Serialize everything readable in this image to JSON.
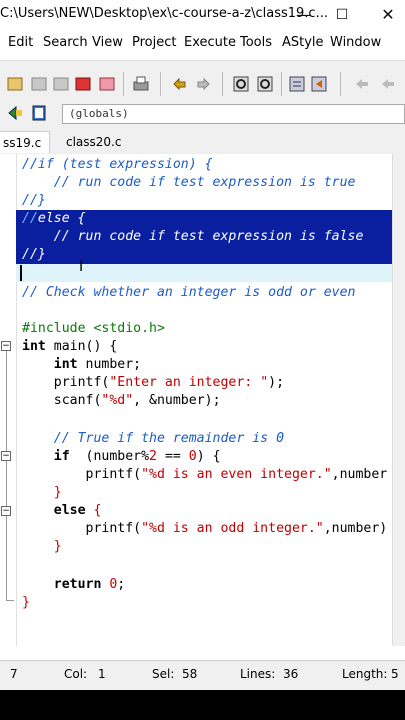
{
  "window": {
    "title": "C:\\Users\\NEW\\Desktop\\ex\\c-course-a-z\\class19.c...",
    "minimize": "—",
    "maximize": "☐",
    "close": "✕"
  },
  "menu": [
    "Edit",
    "Search",
    "View",
    "Project",
    "Execute",
    "Tools",
    "AStyle",
    "Window"
  ],
  "toolbar": {
    "globals": "(globals)",
    "icons": [
      "new-file-icon",
      "open-icon",
      "save-icon",
      "save-all-icon",
      "close-icon",
      "print-icon",
      "undo-icon",
      "redo-icon",
      "find-icon",
      "replace-icon",
      "compile-icon",
      "run-icon",
      "indent-icon",
      "unindent-icon",
      "bookmark-icon",
      "class-browser-icon"
    ]
  },
  "tabs": [
    "ss19.c",
    "class20.c"
  ],
  "code": {
    "l1": "//if (test expression) {",
    "l2": "    // run code if test expression is true",
    "l3": "//}",
    "l4a": "//",
    "l4b": "else {",
    "l5": "    // run code if test expression is false",
    "l6": "//}",
    "l8": "// Check whether an integer is odd or even",
    "l10a": "#include ",
    "l10b": "<stdio.h>",
    "l11a": "int",
    "l11b": " main() {",
    "l12a": "    int",
    "l12b": " number;",
    "l13a": "    printf(",
    "l13b": "\"Enter an integer: \"",
    "l13c": ");",
    "l14a": "    scanf(",
    "l14b": "\"%d\"",
    "l14c": ", &number);",
    "l16": "    // True if the remainder is 0",
    "l17a": "    if",
    "l17b": "  (number%",
    "l17c": "2",
    "l17d": " == ",
    "l17e": "0",
    "l17f": ") {",
    "l18a": "        printf(",
    "l18b": "\"%d is an even integer.\"",
    "l18c": ",number",
    "l19": "    }",
    "l20a": "    else",
    "l20b": " {",
    "l21a": "        printf(",
    "l21b": "\"%d is an odd integer.\"",
    "l21c": ",number)",
    "l22": "    }",
    "l24a": "    return ",
    "l24b": "0",
    "l24c": ";",
    "l25": "}"
  },
  "status": {
    "line": "7",
    "col_label": "Col:",
    "col": "1",
    "sel_label": "Sel:",
    "sel": "58",
    "lines_label": "Lines:",
    "lines": "36",
    "length_label": "Length:",
    "length": "5"
  }
}
